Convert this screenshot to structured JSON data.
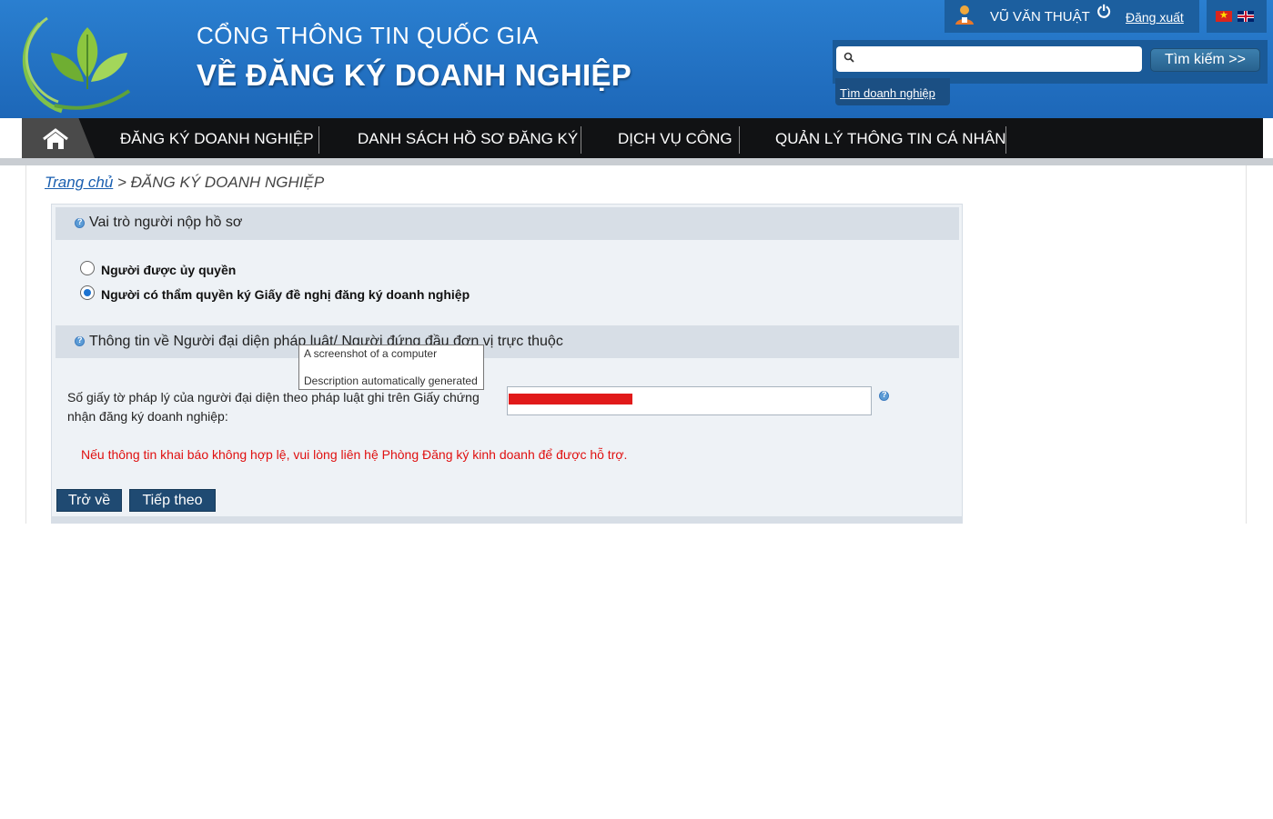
{
  "header": {
    "title_line1": "CỔNG THÔNG TIN QUỐC GIA",
    "title_line2": "VỀ ĐĂNG KÝ DOANH NGHIỆP",
    "user_name": "VŨ VĂN THUẬT",
    "logout_label": "Đăng xuất",
    "search": {
      "value": "",
      "button_label": "Tìm kiếm >>"
    },
    "find_business_link": "Tìm doanh nghiệp"
  },
  "nav": {
    "items": [
      {
        "label": "ĐĂNG KÝ DOANH NGHIỆP"
      },
      {
        "label": "DANH SÁCH HỒ SƠ ĐĂNG KÝ"
      },
      {
        "label": "DỊCH VỤ CÔNG"
      },
      {
        "label": "QUẢN LÝ THÔNG TIN CÁ NHÂN"
      }
    ]
  },
  "breadcrumb": {
    "home": "Trang chủ",
    "separator": " > ",
    "current": "ĐĂNG KÝ DOANH NGHIỆP"
  },
  "form": {
    "section1_title": "Vai trò người nộp hồ sơ",
    "role_options": [
      {
        "label": "Người được ủy quyền",
        "selected": false
      },
      {
        "label": "Người có thẩm quyền ký Giấy đề nghị đăng ký doanh nghiệp",
        "selected": true
      }
    ],
    "section2_title": "Thông tin về Người đại diện pháp luật/ Người đứng đầu đơn vị trực thuộc",
    "id_field_label": "Số giấy tờ pháp lý của người đại diện theo pháp luật ghi trên Giấy chứng nhận đăng ký doanh nghiệp:",
    "warning": "Nếu thông tin khai báo không hợp lệ, vui lòng liên hệ Phòng Đăng ký kinh doanh để được hỗ trợ.",
    "back_button": "Trở về",
    "next_button": "Tiếp theo"
  },
  "tooltip": {
    "line1": "A screenshot of a computer",
    "line2": "Description automatically generated"
  },
  "colors": {
    "header_blue": "#1d67b8",
    "nav_black": "#111214",
    "warning_red": "#e01010",
    "button_navy": "#1f4a72"
  }
}
